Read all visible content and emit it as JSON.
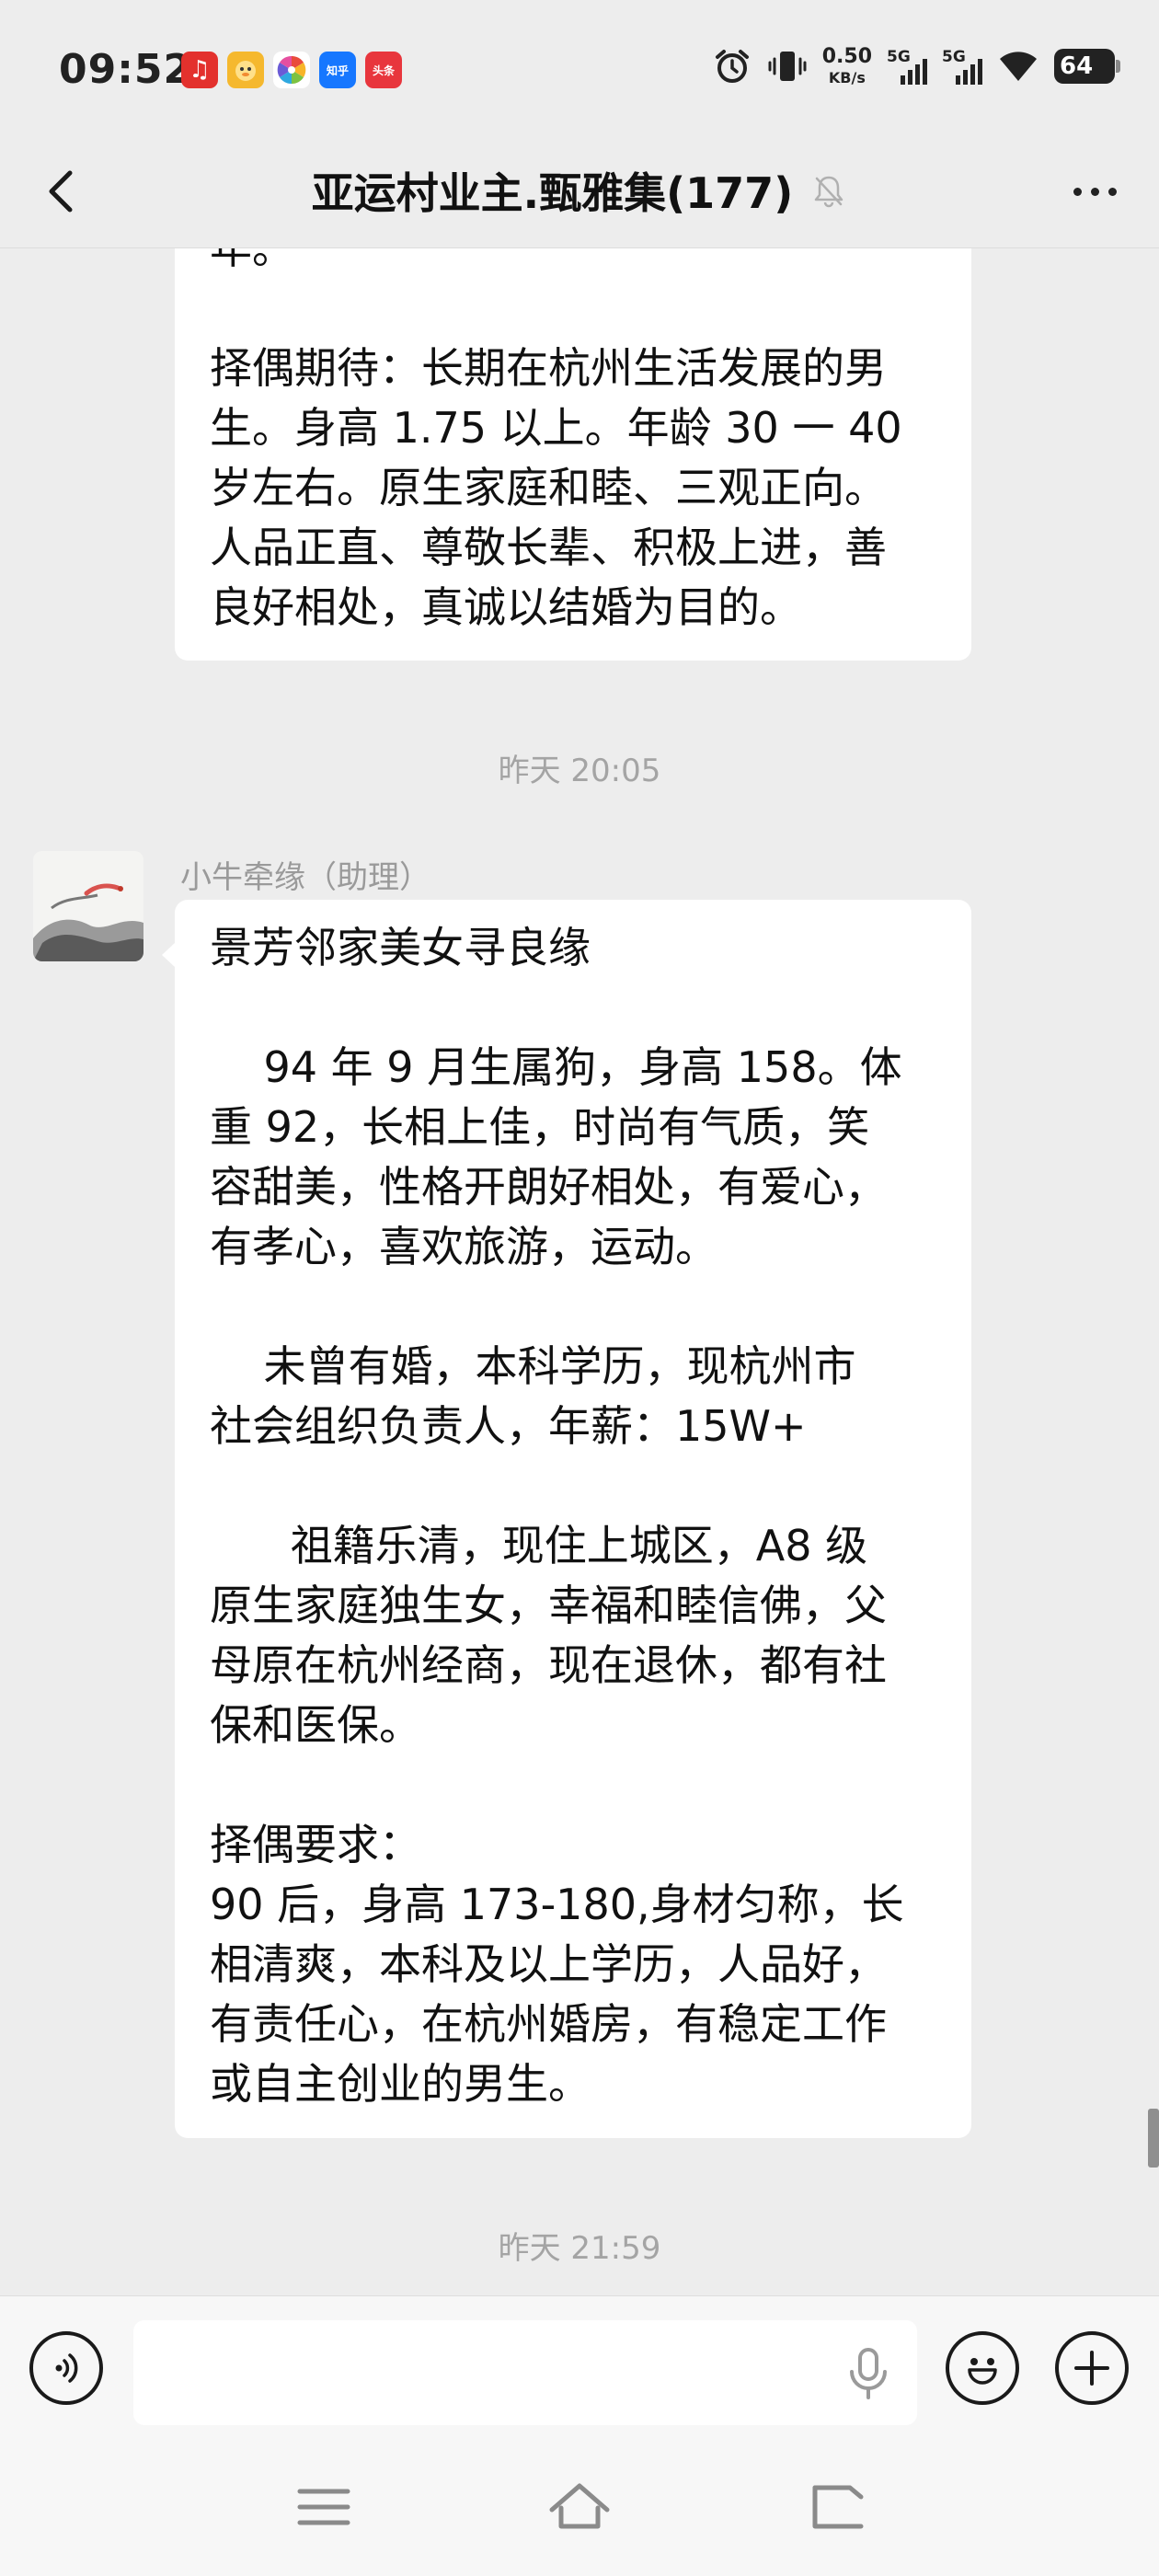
{
  "status_bar": {
    "time": "09:52",
    "apps": [
      {
        "icon": "netease-music-icon",
        "text": "♫",
        "color": "#e3312d"
      },
      {
        "icon": "duck-app-icon",
        "text": "🐤",
        "color": "#f5b82e"
      },
      {
        "icon": "photo-pinwheel-icon",
        "text": "✿",
        "color": "#f0f0f0"
      },
      {
        "icon": "zhihu-icon",
        "text": "知乎",
        "color": "#1677ff"
      },
      {
        "icon": "toutiao-icon",
        "text": "头条",
        "color": "#e8363d"
      }
    ],
    "net_speed_value": "0.50",
    "net_speed_unit": "KB/s",
    "signal_1": "5G",
    "signal_2": "5G",
    "battery": "64"
  },
  "header": {
    "title": "亚运村业主.甄雅集(177)"
  },
  "chat": {
    "message_1": {
      "lines": [
        "年。",
        "",
        "择偶期待：长期在杭州生活发展的男",
        "生。身高 1.75 以上。年龄 30 一 40",
        "岁左右。原生家庭和睦、三观正向。",
        "人品正直、尊敬长辈、积极上进，善",
        "良好相处，真诚以结婚为目的。"
      ]
    },
    "timestamp_1": "昨天 20:05",
    "sender": "小牛牵缘（助理）",
    "message_2": {
      "lines": [
        "景芳邻家美女寻良缘",
        "",
        "    94 年 9 月生属狗，身高 158。体",
        "重 92，长相上佳，时尚有气质，笑",
        "容甜美，性格开朗好相处，有爱心，",
        "有孝心，喜欢旅游，运动。",
        "",
        "    未曾有婚，本科学历，现杭州市",
        "社会组织负责人，年薪：15W+",
        "",
        "      祖籍乐清，现住上城区，A8 级",
        "原生家庭独生女，幸福和睦信佛，父",
        "母原在杭州经商，现在退休，都有社",
        "保和医保。",
        "",
        "择偶要求：",
        "90 后，身高 173-180,身材匀称，长",
        "相清爽，本科及以上学历，人品好，",
        "有责任心，在杭州婚房，有稳定工作",
        "或自主创业的男生。"
      ]
    },
    "timestamp_2": "昨天 21:59"
  },
  "input_bar": {
    "value": "",
    "placeholder": ""
  },
  "colors": {
    "background": "#ededed",
    "bubble": "#ffffff",
    "timestamp_text": "#a4a4a4",
    "bar": "#f7f7f7"
  }
}
